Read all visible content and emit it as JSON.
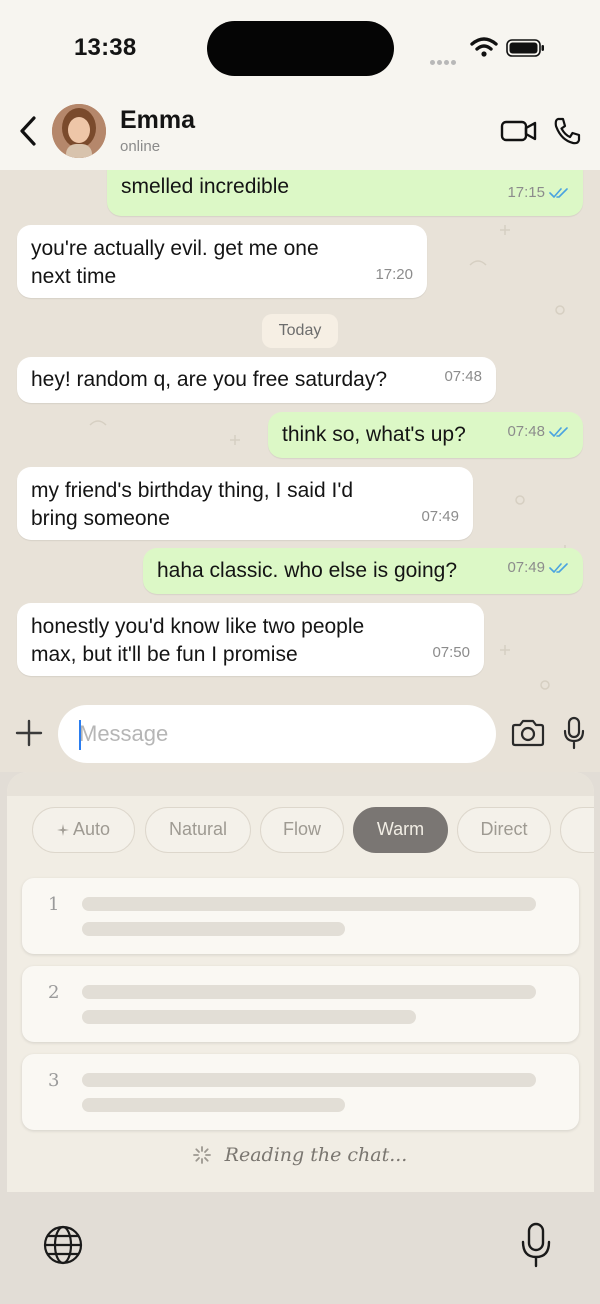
{
  "status_bar": {
    "time": "13:38"
  },
  "header": {
    "contact_name": "Emma",
    "contact_status": "online"
  },
  "chat": {
    "messages": [
      {
        "direction": "out",
        "text": "smelled incredible",
        "time": "17:15",
        "read": true
      },
      {
        "direction": "in",
        "line1": "you're actually evil. get me one",
        "line2": "next time",
        "time": "17:20"
      },
      {
        "direction": "in",
        "text": "hey! random q, are you free saturday?",
        "time": "07:48"
      },
      {
        "direction": "out",
        "text": "think so, what's up?",
        "time": "07:48",
        "read": true
      },
      {
        "direction": "in",
        "line1": "my friend's birthday thing, I said I'd",
        "line2": "bring someone",
        "time": "07:49"
      },
      {
        "direction": "out",
        "text": "haha classic. who else is going?",
        "time": "07:49",
        "read": true
      },
      {
        "direction": "in",
        "line1": "honestly you'd know like two people",
        "line2": "max, but it'll be fun I promise",
        "time": "07:50"
      }
    ],
    "date_separator": "Today"
  },
  "composer": {
    "placeholder": "Message"
  },
  "assistant_panel": {
    "tones": [
      "Auto",
      "Natural",
      "Flow",
      "Warm",
      "Direct"
    ],
    "active_tone": "Warm",
    "suggestions": [
      {
        "number": "1"
      },
      {
        "number": "2"
      },
      {
        "number": "3"
      }
    ],
    "loading_text": "Reading the chat..."
  },
  "colors": {
    "incoming_bubble": "#ffffff",
    "outgoing_bubble": "#dcf8c6",
    "read_ticks": "#4aa3e0",
    "active_chip": "#7a7673"
  },
  "icons": [
    "back-chevron-icon",
    "video-call-icon",
    "phone-call-icon",
    "plus-icon",
    "camera-icon",
    "microphone-icon",
    "globe-icon",
    "sparkle-icon",
    "spinner-icon",
    "double-check-icon"
  ]
}
